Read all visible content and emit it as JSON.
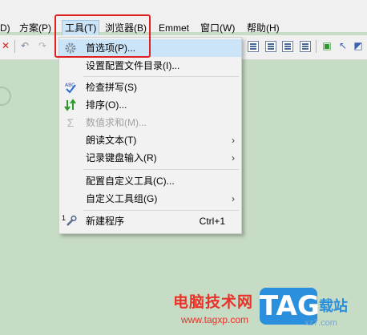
{
  "menubar": {
    "items": [
      "D)",
      "方案(P)",
      "工具(T)",
      "浏览器(B)",
      "Emmet",
      "窗口(W)",
      "帮助(H)"
    ]
  },
  "tools_menu": {
    "items": [
      {
        "label": "首选项(P)...",
        "icon": "gear-icon",
        "highlighted": true
      },
      {
        "label": "设置配置文件目录(I)..."
      },
      {
        "label": "检查拼写(S)",
        "icon": "spellcheck-icon"
      },
      {
        "label": "排序(O)...",
        "icon": "sort-icon"
      },
      {
        "label": "数值求和(M)...",
        "icon": "sigma-icon",
        "disabled": true
      },
      {
        "label": "朗读文本(T)",
        "submenu_arrow": "›"
      },
      {
        "label": "记录键盘输入(R)",
        "submenu_arrow": "›"
      },
      {
        "label": "配置自定义工具(C)..."
      },
      {
        "label": "自定义工具组(G)",
        "submenu_arrow": "›"
      },
      {
        "label": "新建程序",
        "icon": "wrench-icon",
        "shortcut": "Ctrl+1",
        "number": "1"
      }
    ]
  },
  "watermark": {
    "site_name": "电脑技术网",
    "url": "www.tagxp.com",
    "logo": "TAG",
    "cn": "载站",
    "sub": "xz7.com"
  },
  "colors": {
    "highlight_border": "#e02020",
    "menu_highlight": "#cce4f7",
    "background": "#c6dcc4"
  }
}
